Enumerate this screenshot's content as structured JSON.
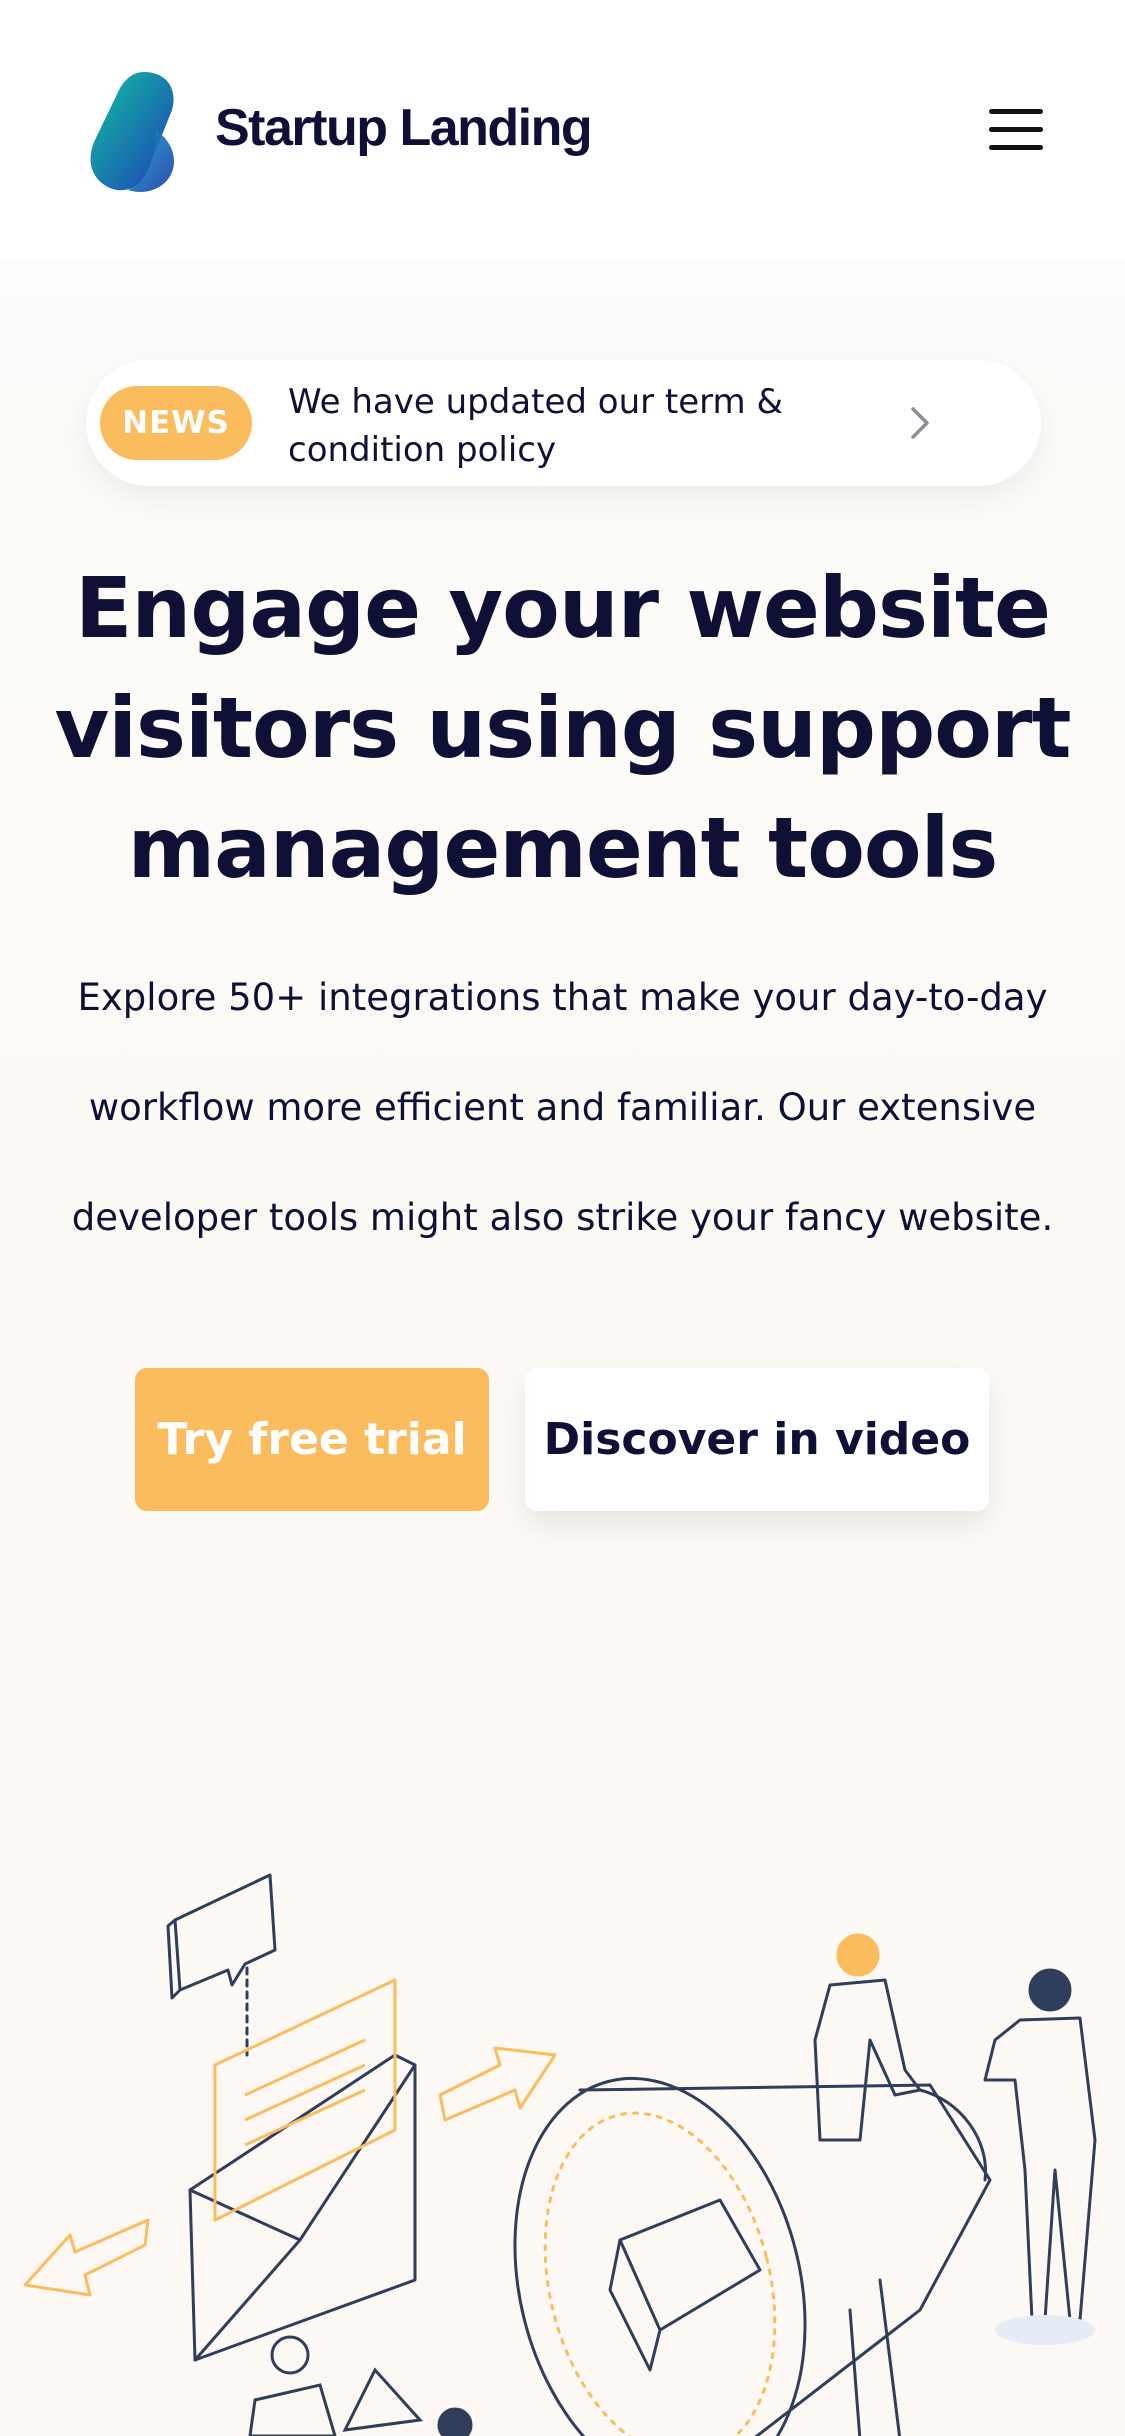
{
  "header": {
    "brand": "Startup Landing",
    "logo_icon": "leaf-gradient-logo",
    "menu_icon": "hamburger-menu-icon"
  },
  "news": {
    "badge": "NEWS",
    "text": "We have updated our term & condition policy",
    "arrow_icon": "chevron-right-icon"
  },
  "hero": {
    "headline": "Engage your website visitors using support management tools",
    "subtext": "Explore 50+ integrations that make your day-to-day workflow more efficient and familiar. Our extensive developer tools might also strike your fancy website.",
    "primary_button": "Try free trial",
    "secondary_button": "Discover in video"
  },
  "colors": {
    "accent": "#fbbc5e",
    "text": "#0f1035",
    "logo_gradient_start": "#10c3a0",
    "logo_gradient_end": "#1f3db8",
    "illustration_stroke": "#2f3e5a"
  }
}
